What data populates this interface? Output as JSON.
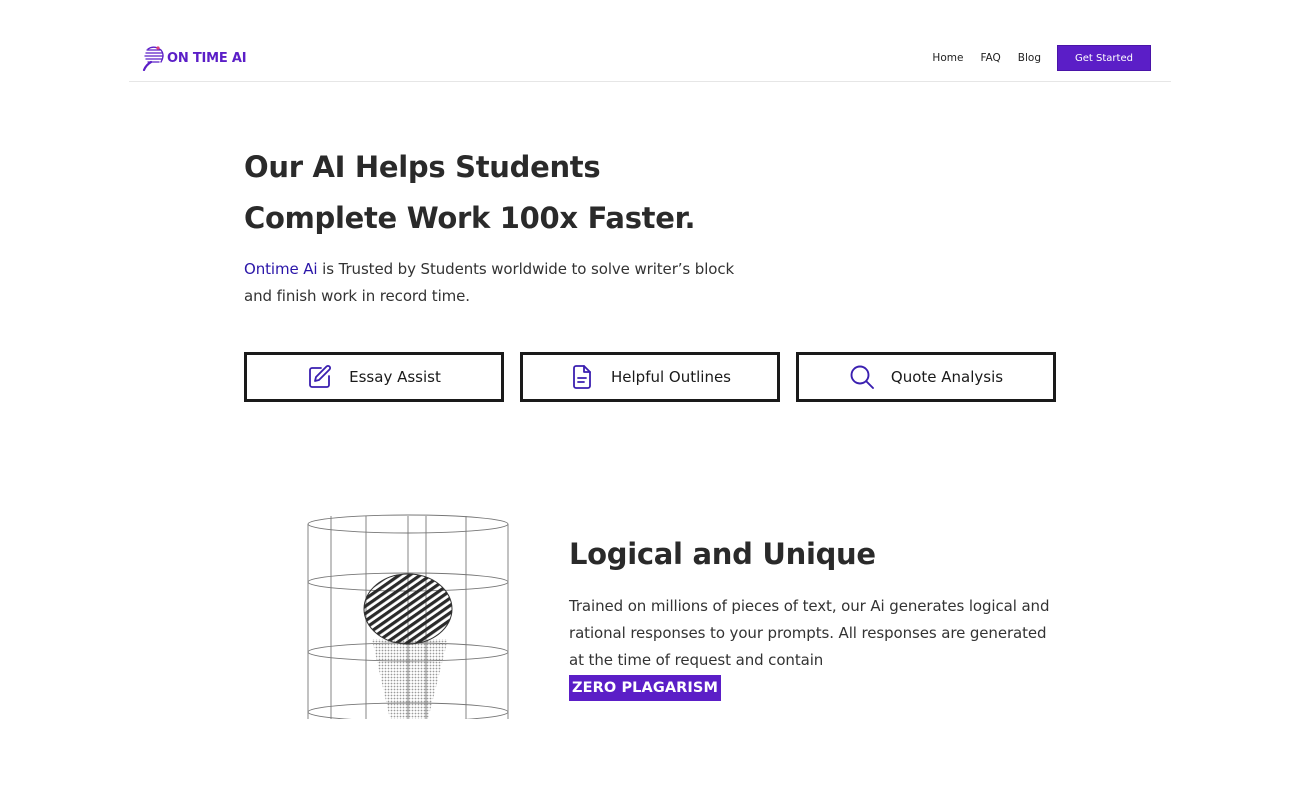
{
  "nav": {
    "logo_text": "ON TIME AI",
    "links": [
      "Home",
      "FAQ",
      "Blog"
    ],
    "cta_label": "Get Started"
  },
  "hero": {
    "title_line1": "Our AI Helps Students",
    "title_line2": "Complete Work 100x Faster.",
    "subtitle_brand": "Ontime Ai",
    "subtitle_rest": " is Trusted by Students worldwide to solve writer’s block and finish work in record time."
  },
  "features": [
    {
      "label": "Essay Assist",
      "icon": "pencil-edit-icon"
    },
    {
      "label": "Helpful Outlines",
      "icon": "document-icon"
    },
    {
      "label": "Quote Analysis",
      "icon": "search-icon"
    }
  ],
  "section": {
    "title": "Logical and Unique",
    "body": "Trained on millions of pieces of text, our Ai generates logical and rational responses to your prompts. All responses are generated at the time of request and contain",
    "badge": "ZERO PLAGARISM"
  },
  "colors": {
    "accent": "#5b1ec7",
    "brand_link": "#2a15a8",
    "text": "#2a2a2a"
  }
}
